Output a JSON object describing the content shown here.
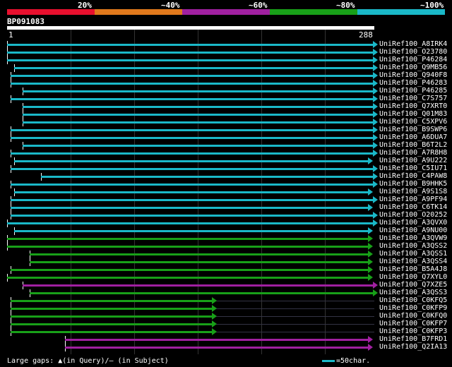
{
  "legend": {
    "labels": [
      "20%",
      "~40%",
      "~60%",
      "~80%",
      "~100%"
    ],
    "colors": [
      "#e8102e",
      "#e0791c",
      "#a020a0",
      "#18a018",
      "#1ab8c8"
    ]
  },
  "query": {
    "id": "BP091083",
    "start": "1",
    "end": "288"
  },
  "hits": [
    {
      "name": "UniRef100_A8IRK4",
      "color": "#1ab8c8"
    },
    {
      "name": "UniRef100_O23780",
      "color": "#1ab8c8"
    },
    {
      "name": "UniRef100_P46284",
      "color": "#1ab8c8"
    },
    {
      "name": "UniRef100_Q9MB56",
      "color": "#1ab8c8"
    },
    {
      "name": "UniRef100_Q940F8",
      "color": "#1ab8c8"
    },
    {
      "name": "UniRef100_P46283",
      "color": "#1ab8c8"
    },
    {
      "name": "UniRef100_P46285",
      "color": "#1ab8c8"
    },
    {
      "name": "UniRef100_C7S757",
      "color": "#1ab8c8"
    },
    {
      "name": "UniRef100_Q7XRT0",
      "color": "#1ab8c8"
    },
    {
      "name": "UniRef100_Q01M83",
      "color": "#1ab8c8"
    },
    {
      "name": "UniRef100_C5XPV6",
      "color": "#1ab8c8"
    },
    {
      "name": "UniRef100_B9SWP6",
      "color": "#1ab8c8"
    },
    {
      "name": "UniRef100_A6DUA7",
      "color": "#1ab8c8"
    },
    {
      "name": "UniRef100_B6T2L2",
      "color": "#1ab8c8"
    },
    {
      "name": "UniRef100_A7R8H8",
      "color": "#1ab8c8"
    },
    {
      "name": "UniRef100_A9U222",
      "color": "#1ab8c8"
    },
    {
      "name": "UniRef100_C5IU71",
      "color": "#1ab8c8"
    },
    {
      "name": "UniRef100_C4PAW8",
      "color": "#1ab8c8"
    },
    {
      "name": "UniRef100_B9HHK5",
      "color": "#1ab8c8"
    },
    {
      "name": "UniRef100_A9S1S8",
      "color": "#1ab8c8"
    },
    {
      "name": "UniRef100_A9PF94",
      "color": "#1ab8c8"
    },
    {
      "name": "UniRef100_C6TK14",
      "color": "#1ab8c8"
    },
    {
      "name": "UniRef100_O20252",
      "color": "#1ab8c8"
    },
    {
      "name": "UniRef100_A3QVX0",
      "color": "#1ab8c8"
    },
    {
      "name": "UniRef100_A9NU00",
      "color": "#1ab8c8"
    },
    {
      "name": "UniRef100_A3QVW9",
      "color": "#18a018"
    },
    {
      "name": "UniRef100_A3QSS2",
      "color": "#18a018"
    },
    {
      "name": "UniRef100_A3QSS1",
      "color": "#18a018"
    },
    {
      "name": "UniRef100_A3QSS4",
      "color": "#18a018"
    },
    {
      "name": "UniRef100_B5A4J8",
      "color": "#18a018"
    },
    {
      "name": "UniRef100_Q7XYL0",
      "color": "#18a018"
    },
    {
      "name": "UniRef100_Q7XZE5",
      "color": "#a020a0"
    },
    {
      "name": "UniRef100_A3QSS3",
      "color": "#18a018"
    },
    {
      "name": "UniRef100_C0KFQ5",
      "color": "#18a018"
    },
    {
      "name": "UniRef100_C0KFP9",
      "color": "#18a018"
    },
    {
      "name": "UniRef100_C0KFQ0",
      "color": "#18a018"
    },
    {
      "name": "UniRef100_C0KFP7",
      "color": "#18a018"
    },
    {
      "name": "UniRef100_C0KFP3",
      "color": "#18a018"
    },
    {
      "name": "UniRef100_B7FRD1",
      "color": "#a020a0"
    },
    {
      "name": "UniRef100_Q2IA13",
      "color": "#a020a0"
    }
  ],
  "footer": {
    "gaps_label": "Large gaps: ▲(in Query)/— (in Subject)",
    "scale_label": "=50char."
  }
}
